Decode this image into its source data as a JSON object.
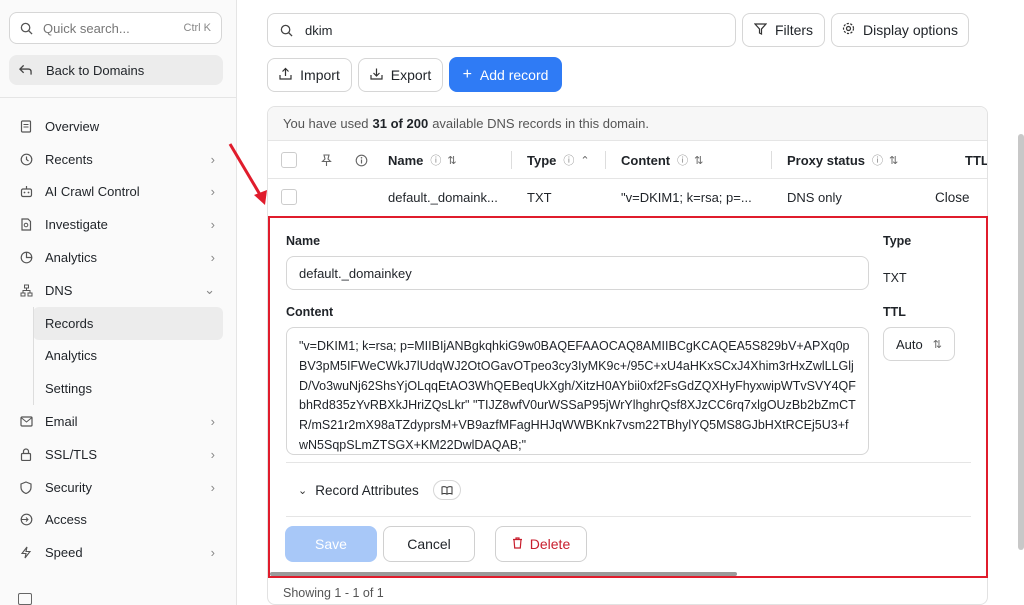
{
  "sidebar": {
    "search_placeholder": "Quick search...",
    "search_shortcut": "Ctrl K",
    "back_label": "Back to Domains",
    "items": [
      {
        "label": "Overview",
        "icon": "document-icon",
        "chevron": false
      },
      {
        "label": "Recents",
        "icon": "clock-icon",
        "chevron": true
      },
      {
        "label": "AI Crawl Control",
        "icon": "robot-icon",
        "chevron": true
      },
      {
        "label": "Investigate",
        "icon": "file-search-icon",
        "chevron": true
      },
      {
        "label": "Analytics",
        "icon": "pie-chart-icon",
        "chevron": true
      },
      {
        "label": "DNS",
        "icon": "network-icon",
        "chevron": true
      }
    ],
    "dns_sub": [
      "Records",
      "Analytics",
      "Settings"
    ],
    "items_after": [
      {
        "label": "Email",
        "icon": "mail-icon",
        "chevron": true
      },
      {
        "label": "SSL/TLS",
        "icon": "lock-icon",
        "chevron": true
      },
      {
        "label": "Security",
        "icon": "shield-icon",
        "chevron": true
      },
      {
        "label": "Access",
        "icon": "access-icon",
        "chevron": false
      },
      {
        "label": "Speed",
        "icon": "bolt-icon",
        "chevron": true
      }
    ]
  },
  "toolbar": {
    "search_value": "dkim",
    "filters_label": "Filters",
    "display_options_label": "Display options",
    "import_label": "Import",
    "export_label": "Export",
    "add_record_label": "Add record"
  },
  "usage": {
    "prefix": "You have used",
    "count": "31 of 200",
    "suffix": "available DNS records in this domain."
  },
  "table": {
    "headers": {
      "name": "Name",
      "type": "Type",
      "content": "Content",
      "proxy": "Proxy status",
      "ttl": "TTL"
    },
    "row": {
      "name": "default._domaink...",
      "type": "TXT",
      "content": "\"v=DKIM1; k=rsa; p=...",
      "proxy": "DNS only",
      "action": "Close"
    }
  },
  "edit": {
    "name_label": "Name",
    "name_value": "default._domainkey",
    "type_label": "Type",
    "type_value": "TXT",
    "content_label": "Content",
    "content_value": "\"v=DKIM1; k=rsa; p=MIIBIjANBgkqhkiG9w0BAQEFAAOCAQ8AMIIBCgKCAQEA5S829bV+APXq0pBV3pM5IFWeCWkJ7lUdqWJ2OtOGavOTpeo3cy3IyMK9c+/95C+xU4aHKxSCxJ4Xhim3rHxZwlLLGljD/Vo3wuNj62ShsYjOLqqEtAO3WhQEBeqUkXgh/XitzH0AYbii0xf2FsGdZQXHyFhyxwipWTvSVY4QFbhRd835zYvRBXkJHriZQsLkr\" \"TIJZ8wfV0urWSSaP95jWrYlhghrQsf8XJzCC6rq7xlgOUzBb2bZmCTR/mS21r2mX98aTZdyprsM+VB9azfMFagHHJqWWBKnk7vsm22TBhylYQ5MS8GJbHXtRCEj5U3+fwN5SqpSLmZTSGX+KM22DwlDAQAB;\"",
    "ttl_label": "TTL",
    "ttl_value": "Auto",
    "attributes_label": "Record Attributes",
    "save_label": "Save",
    "cancel_label": "Cancel",
    "delete_label": "Delete"
  },
  "footer": {
    "showing": "Showing 1 - 1 of 1"
  },
  "colors": {
    "primary": "#2f7bf5",
    "highlight_border": "#e01c2c",
    "delete": "#c81e2d"
  }
}
